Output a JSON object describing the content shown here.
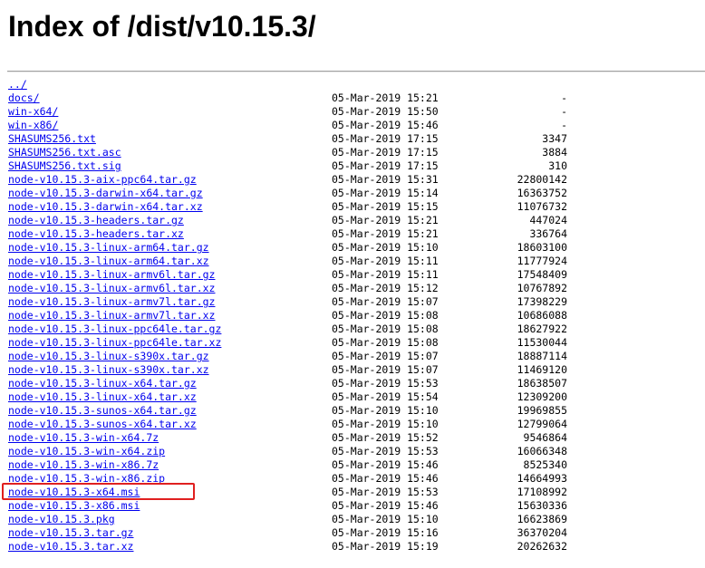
{
  "title": "Index of /dist/v10.15.3/",
  "listing": [
    {
      "name": "../",
      "date": "",
      "size": ""
    },
    {
      "name": "docs/",
      "date": "05-Mar-2019 15:21",
      "size": "-"
    },
    {
      "name": "win-x64/",
      "date": "05-Mar-2019 15:50",
      "size": "-"
    },
    {
      "name": "win-x86/",
      "date": "05-Mar-2019 15:46",
      "size": "-"
    },
    {
      "name": "SHASUMS256.txt",
      "date": "05-Mar-2019 17:15",
      "size": "3347"
    },
    {
      "name": "SHASUMS256.txt.asc",
      "date": "05-Mar-2019 17:15",
      "size": "3884"
    },
    {
      "name": "SHASUMS256.txt.sig",
      "date": "05-Mar-2019 17:15",
      "size": "310"
    },
    {
      "name": "node-v10.15.3-aix-ppc64.tar.gz",
      "date": "05-Mar-2019 15:31",
      "size": "22800142"
    },
    {
      "name": "node-v10.15.3-darwin-x64.tar.gz",
      "date": "05-Mar-2019 15:14",
      "size": "16363752"
    },
    {
      "name": "node-v10.15.3-darwin-x64.tar.xz",
      "date": "05-Mar-2019 15:15",
      "size": "11076732"
    },
    {
      "name": "node-v10.15.3-headers.tar.gz",
      "date": "05-Mar-2019 15:21",
      "size": "447024"
    },
    {
      "name": "node-v10.15.3-headers.tar.xz",
      "date": "05-Mar-2019 15:21",
      "size": "336764"
    },
    {
      "name": "node-v10.15.3-linux-arm64.tar.gz",
      "date": "05-Mar-2019 15:10",
      "size": "18603100"
    },
    {
      "name": "node-v10.15.3-linux-arm64.tar.xz",
      "date": "05-Mar-2019 15:11",
      "size": "11777924"
    },
    {
      "name": "node-v10.15.3-linux-armv6l.tar.gz",
      "date": "05-Mar-2019 15:11",
      "size": "17548409"
    },
    {
      "name": "node-v10.15.3-linux-armv6l.tar.xz",
      "date": "05-Mar-2019 15:12",
      "size": "10767892"
    },
    {
      "name": "node-v10.15.3-linux-armv7l.tar.gz",
      "date": "05-Mar-2019 15:07",
      "size": "17398229"
    },
    {
      "name": "node-v10.15.3-linux-armv7l.tar.xz",
      "date": "05-Mar-2019 15:08",
      "size": "10686088"
    },
    {
      "name": "node-v10.15.3-linux-ppc64le.tar.gz",
      "date": "05-Mar-2019 15:08",
      "size": "18627922"
    },
    {
      "name": "node-v10.15.3-linux-ppc64le.tar.xz",
      "date": "05-Mar-2019 15:08",
      "size": "11530044"
    },
    {
      "name": "node-v10.15.3-linux-s390x.tar.gz",
      "date": "05-Mar-2019 15:07",
      "size": "18887114"
    },
    {
      "name": "node-v10.15.3-linux-s390x.tar.xz",
      "date": "05-Mar-2019 15:07",
      "size": "11469120"
    },
    {
      "name": "node-v10.15.3-linux-x64.tar.gz",
      "date": "05-Mar-2019 15:53",
      "size": "18638507"
    },
    {
      "name": "node-v10.15.3-linux-x64.tar.xz",
      "date": "05-Mar-2019 15:54",
      "size": "12309200"
    },
    {
      "name": "node-v10.15.3-sunos-x64.tar.gz",
      "date": "05-Mar-2019 15:10",
      "size": "19969855"
    },
    {
      "name": "node-v10.15.3-sunos-x64.tar.xz",
      "date": "05-Mar-2019 15:10",
      "size": "12799064"
    },
    {
      "name": "node-v10.15.3-win-x64.7z",
      "date": "05-Mar-2019 15:52",
      "size": "9546864"
    },
    {
      "name": "node-v10.15.3-win-x64.zip",
      "date": "05-Mar-2019 15:53",
      "size": "16066348"
    },
    {
      "name": "node-v10.15.3-win-x86.7z",
      "date": "05-Mar-2019 15:46",
      "size": "8525340"
    },
    {
      "name": "node-v10.15.3-win-x86.zip",
      "date": "05-Mar-2019 15:46",
      "size": "14664993"
    },
    {
      "name": "node-v10.15.3-x64.msi",
      "date": "05-Mar-2019 15:53",
      "size": "17108992"
    },
    {
      "name": "node-v10.15.3-x86.msi",
      "date": "05-Mar-2019 15:46",
      "size": "15630336"
    },
    {
      "name": "node-v10.15.3.pkg",
      "date": "05-Mar-2019 15:10",
      "size": "16623869"
    },
    {
      "name": "node-v10.15.3.tar.gz",
      "date": "05-Mar-2019 15:16",
      "size": "36370204"
    },
    {
      "name": "node-v10.15.3.tar.xz",
      "date": "05-Mar-2019 15:19",
      "size": "20262632"
    }
  ],
  "colors": {
    "link": "#0000ee",
    "highlight": "#e02020"
  }
}
